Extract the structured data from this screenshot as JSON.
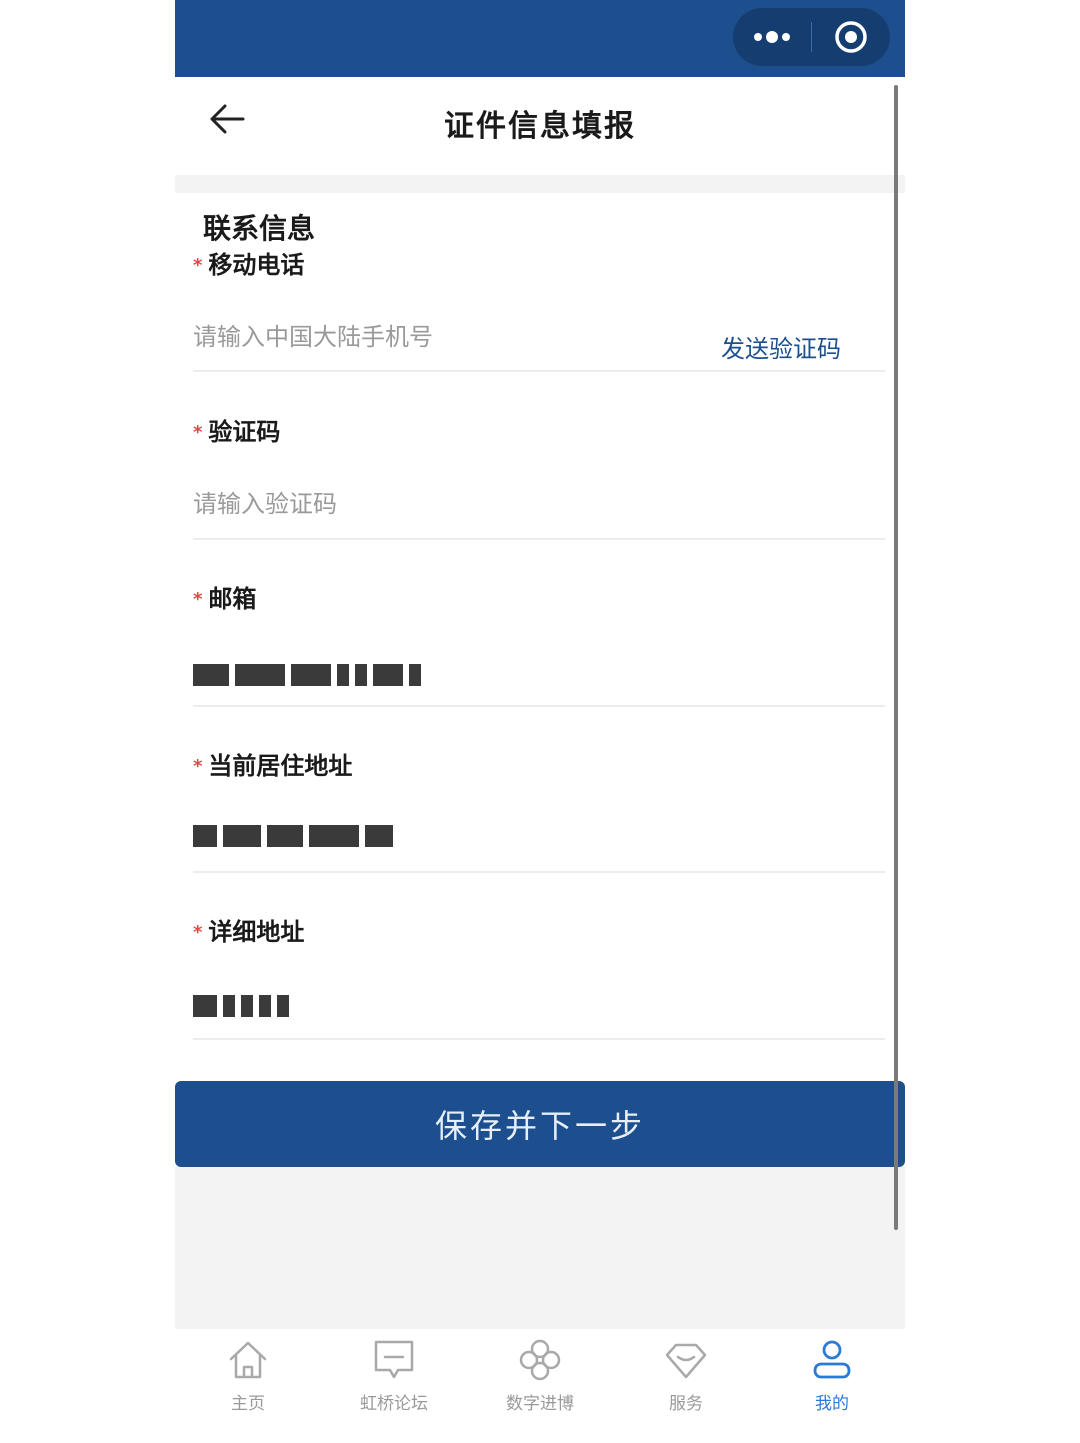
{
  "nav": {
    "title": "证件信息填报"
  },
  "form": {
    "section_title": "联系信息",
    "required_mark": "*",
    "phone": {
      "label": "移动电话",
      "placeholder": "请输入中国大陆手机号",
      "send_code": "发送验证码"
    },
    "code": {
      "label": "验证码",
      "placeholder": "请输入验证码"
    },
    "email": {
      "label": "邮箱"
    },
    "address": {
      "label": "当前居住地址"
    },
    "detail": {
      "label": "详细地址"
    }
  },
  "save_button": "保存并下一步",
  "tabs": [
    {
      "label": "主页",
      "icon": "home-icon"
    },
    {
      "label": "虹桥论坛",
      "icon": "chat-icon"
    },
    {
      "label": "数字进博",
      "icon": "clover-icon"
    },
    {
      "label": "服务",
      "icon": "diamond-icon"
    },
    {
      "label": "我的",
      "icon": "user-icon"
    }
  ],
  "colors": {
    "primary": "#1d4f8e",
    "active_tab": "#2a7bd6",
    "required": "#e04848"
  }
}
